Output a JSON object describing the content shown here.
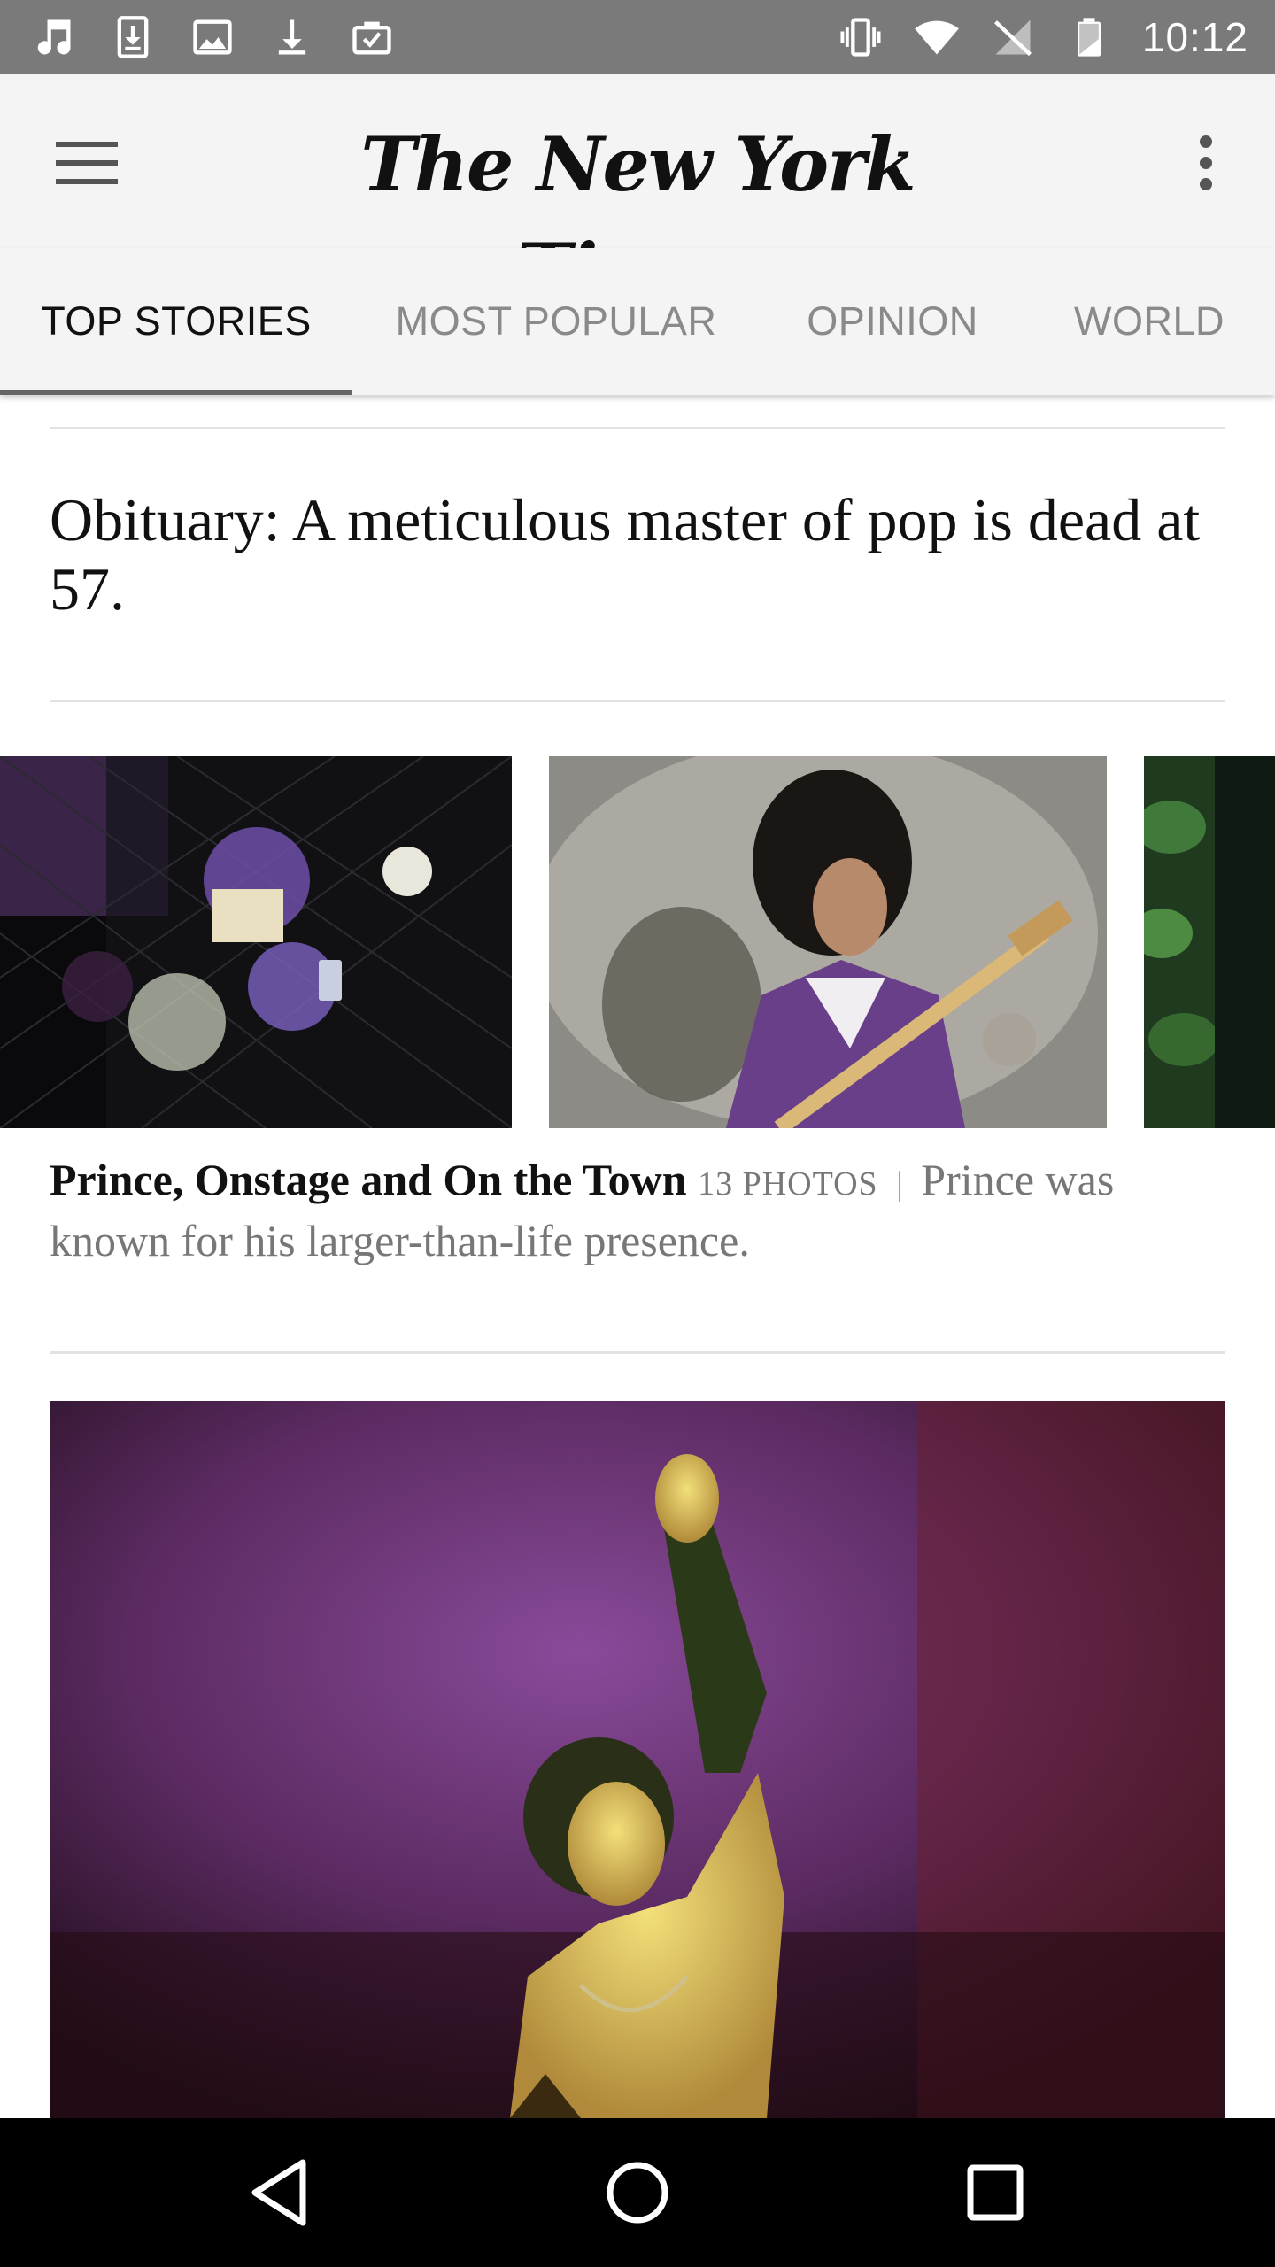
{
  "status_bar": {
    "time": "10:12",
    "left_icons": [
      "music-icon",
      "download-box-icon",
      "image-icon",
      "download-icon",
      "work-icon"
    ],
    "right_icons": [
      "vibrate-icon",
      "wifi-icon",
      "no-signal-icon",
      "battery-icon"
    ]
  },
  "app_bar": {
    "logo_text": "The New York Times",
    "menu_icon": "hamburger-menu-icon",
    "overflow_icon": "more-vert-icon"
  },
  "tabs": [
    {
      "label": "TOP STORIES",
      "active": true
    },
    {
      "label": "MOST POPULAR",
      "active": false
    },
    {
      "label": "OPINION",
      "active": false
    },
    {
      "label": "WORLD",
      "active": false
    }
  ],
  "article": {
    "headline": "Obituary: A meticulous master of pop is dead at 57."
  },
  "gallery": {
    "title": "Prince, Onstage and On the Town",
    "count": "13 PHOTOS",
    "separator": "|",
    "summary": "Prince was known for his larger-than-life presence."
  },
  "nav_bar": {
    "back_icon": "back-triangle-icon",
    "home_icon": "home-circle-icon",
    "recents_icon": "recents-square-icon"
  },
  "colors": {
    "status_bar": "#7a7a7a",
    "app_bar": "#f4f4f4",
    "active_tab": "#111111",
    "inactive_tab": "#8a8a8a",
    "nav_bar": "#000000"
  }
}
